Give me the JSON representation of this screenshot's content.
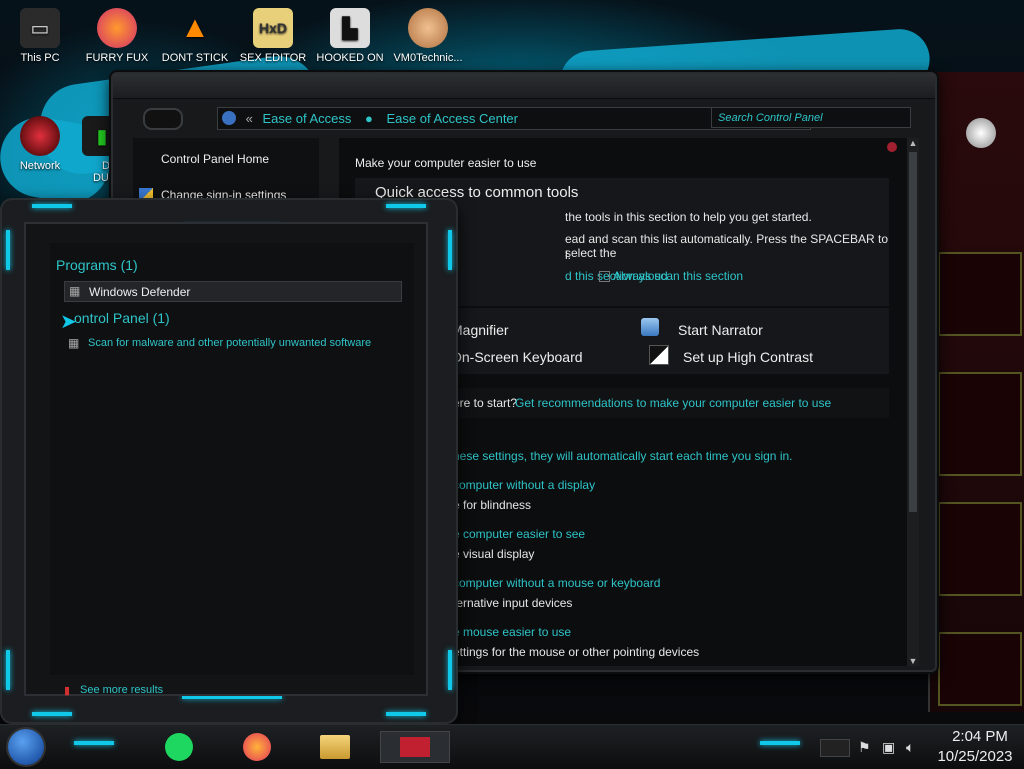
{
  "desktop": {
    "icons": [
      {
        "label": "This PC"
      },
      {
        "label": "FURRY FUX"
      },
      {
        "label": "DONT STICK"
      },
      {
        "label": "SEX EDITOR"
      },
      {
        "label": "HOOKED ON"
      },
      {
        "label": "VM0Technic..."
      },
      {
        "label": "Network"
      },
      {
        "label": "D"
      },
      {
        "label": "DUM"
      }
    ]
  },
  "control_panel": {
    "breadcrumb": [
      "Ease of Access",
      "Ease of Access Center"
    ],
    "search_placeholder": "Search Control Panel",
    "left_links": [
      "Control Panel Home",
      "Change sign-in settings"
    ],
    "main": {
      "title": "Make your computer easier to use",
      "quick_heading": "Quick access to common tools",
      "quick_text_1": "the tools in this section to help you get started.",
      "quick_text_2a": "ead and scan this list automatically.  Press the SPACEBAR to select the",
      "quick_text_2b": "l.",
      "read_aloud": "d this section aloud",
      "always_scan": "Always scan this section",
      "tools": [
        "Magnifier",
        "Start Narrator",
        "On-Screen Keyboard",
        "Set up High Contrast"
      ],
      "not_sure_prefix": "ere to start?",
      "not_sure_link": "Get recommendations to make your computer easier to use",
      "explore_text": "hese settings, they will automatically start each time you sign in.",
      "settings": [
        {
          "link": "computer without a display",
          "desc": "e for blindness"
        },
        {
          "link": "e computer easier to see",
          "desc": "e visual display"
        },
        {
          "link": "computer without a mouse or keyboard",
          "desc": "ternative input devices"
        },
        {
          "link": "e mouse easier to use",
          "desc": "ettings for the mouse or other pointing devices"
        }
      ]
    }
  },
  "search_flyout": {
    "group1_title": "Programs (1)",
    "group1_item": "Windows Defender",
    "group2_title": "ontrol Panel (1)",
    "group2_item": "Scan for malware and other potentially unwanted software",
    "see_more": "See more results"
  },
  "taskbar": {
    "time": "2:04 PM",
    "date": "10/25/2023"
  },
  "colors": {
    "accent": "#2ec4c8",
    "glow": "#10c8e8",
    "panel": "#17191b"
  }
}
